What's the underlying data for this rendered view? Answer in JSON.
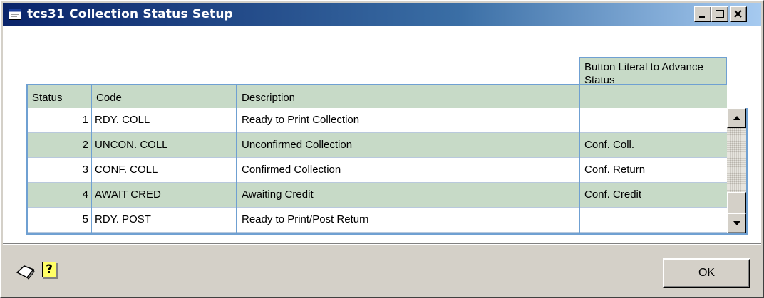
{
  "window": {
    "title": "tcs31 Collection Status Setup",
    "colors": {
      "title_start": "#0a246a",
      "title_end": "#a6caf0",
      "row_alt": "#c7dac7",
      "grid_line": "#6fa0d2"
    }
  },
  "grid": {
    "columns": {
      "status": "Status",
      "code": "Code",
      "description": "Description",
      "button_literal": "Button Literal to Advance Status"
    },
    "rows": [
      {
        "status": "1",
        "code": "RDY. COLL",
        "description": "Ready to Print Collection",
        "button_literal": ""
      },
      {
        "status": "2",
        "code": "UNCON. COLL",
        "description": "Unconfirmed Collection",
        "button_literal": "Conf. Coll."
      },
      {
        "status": "3",
        "code": "CONF. COLL",
        "description": "Confirmed Collection",
        "button_literal": "Conf. Return"
      },
      {
        "status": "4",
        "code": "AWAIT CRED",
        "description": "Awaiting Credit",
        "button_literal": "Conf. Credit"
      },
      {
        "status": "5",
        "code": "RDY. POST",
        "description": "Ready to Print/Post Return",
        "button_literal": ""
      }
    ]
  },
  "footer": {
    "ok_label": "OK",
    "icons": [
      "note-icon",
      "help-icon"
    ],
    "help_glyph": "?"
  }
}
